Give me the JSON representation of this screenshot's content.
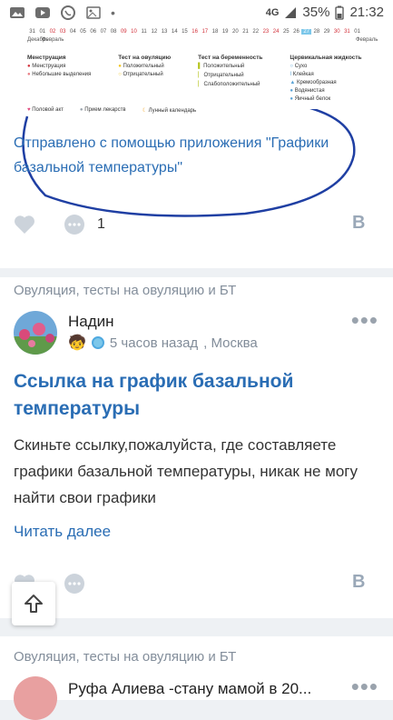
{
  "status_bar": {
    "network": "4G",
    "battery": "35%",
    "time": "21:32"
  },
  "calendar": {
    "days": [
      "31",
      "01",
      "02",
      "03",
      "04",
      "05",
      "06",
      "07",
      "08",
      "09",
      "10",
      "11",
      "12",
      "13",
      "14",
      "15",
      "16",
      "17",
      "18",
      "19",
      "20",
      "21",
      "22",
      "23",
      "24",
      "25",
      "26",
      "27",
      "28",
      "29",
      "30",
      "31",
      "01"
    ],
    "red_days": [
      "02",
      "03",
      "09",
      "10",
      "16",
      "17",
      "23",
      "24",
      "30",
      "31"
    ],
    "selected_day": "27",
    "month_left": "Декабрь",
    "month_mid": "Февраль",
    "month_right": "Февраль"
  },
  "legend": {
    "col1": {
      "title": "Менструация",
      "items": [
        "Менструация",
        "Небольшие выделения"
      ]
    },
    "col2": {
      "title": "Тест на овуляцию",
      "items": [
        "Положительный",
        "Отрицательный"
      ]
    },
    "col3": {
      "title": "Тест на беременность",
      "items": [
        "Положительный",
        "Отрицательный",
        "Слабоположительный"
      ]
    },
    "col4": {
      "title": "Цервикальная жидкость",
      "items": [
        "Сухо",
        "Клейкая",
        "Кремообразная",
        "Водянистая",
        "Яичный белок"
      ]
    },
    "bottom": [
      "Половой акт",
      "Прием лекарств",
      "Лунный календарь"
    ]
  },
  "post1": {
    "sent_text": "Отправлено с помощью приложения \"Графики базальной температуры\"",
    "comments_count": "1",
    "vk_badge": "B"
  },
  "post2": {
    "category": "Овуляция, тесты на овуляцию и БТ",
    "author": "Надин",
    "time": "5 часов назад",
    "location": ", Москва",
    "title": "Ссылка на график базальной температуры",
    "body": "Скиньте ссылку,пожалуйста, где составляете графики базальной температуры, никак не могу найти свои графики",
    "read_more": "Читать далее",
    "vk_badge": "B"
  },
  "post3": {
    "category": "Овуляция, тесты на овуляцию и БТ",
    "author": "Руфа Алиева -стану мамой в 20..."
  },
  "colors": {
    "accent": "#2a6db4",
    "muted": "#818c99",
    "oval": "#1f3fa3"
  }
}
